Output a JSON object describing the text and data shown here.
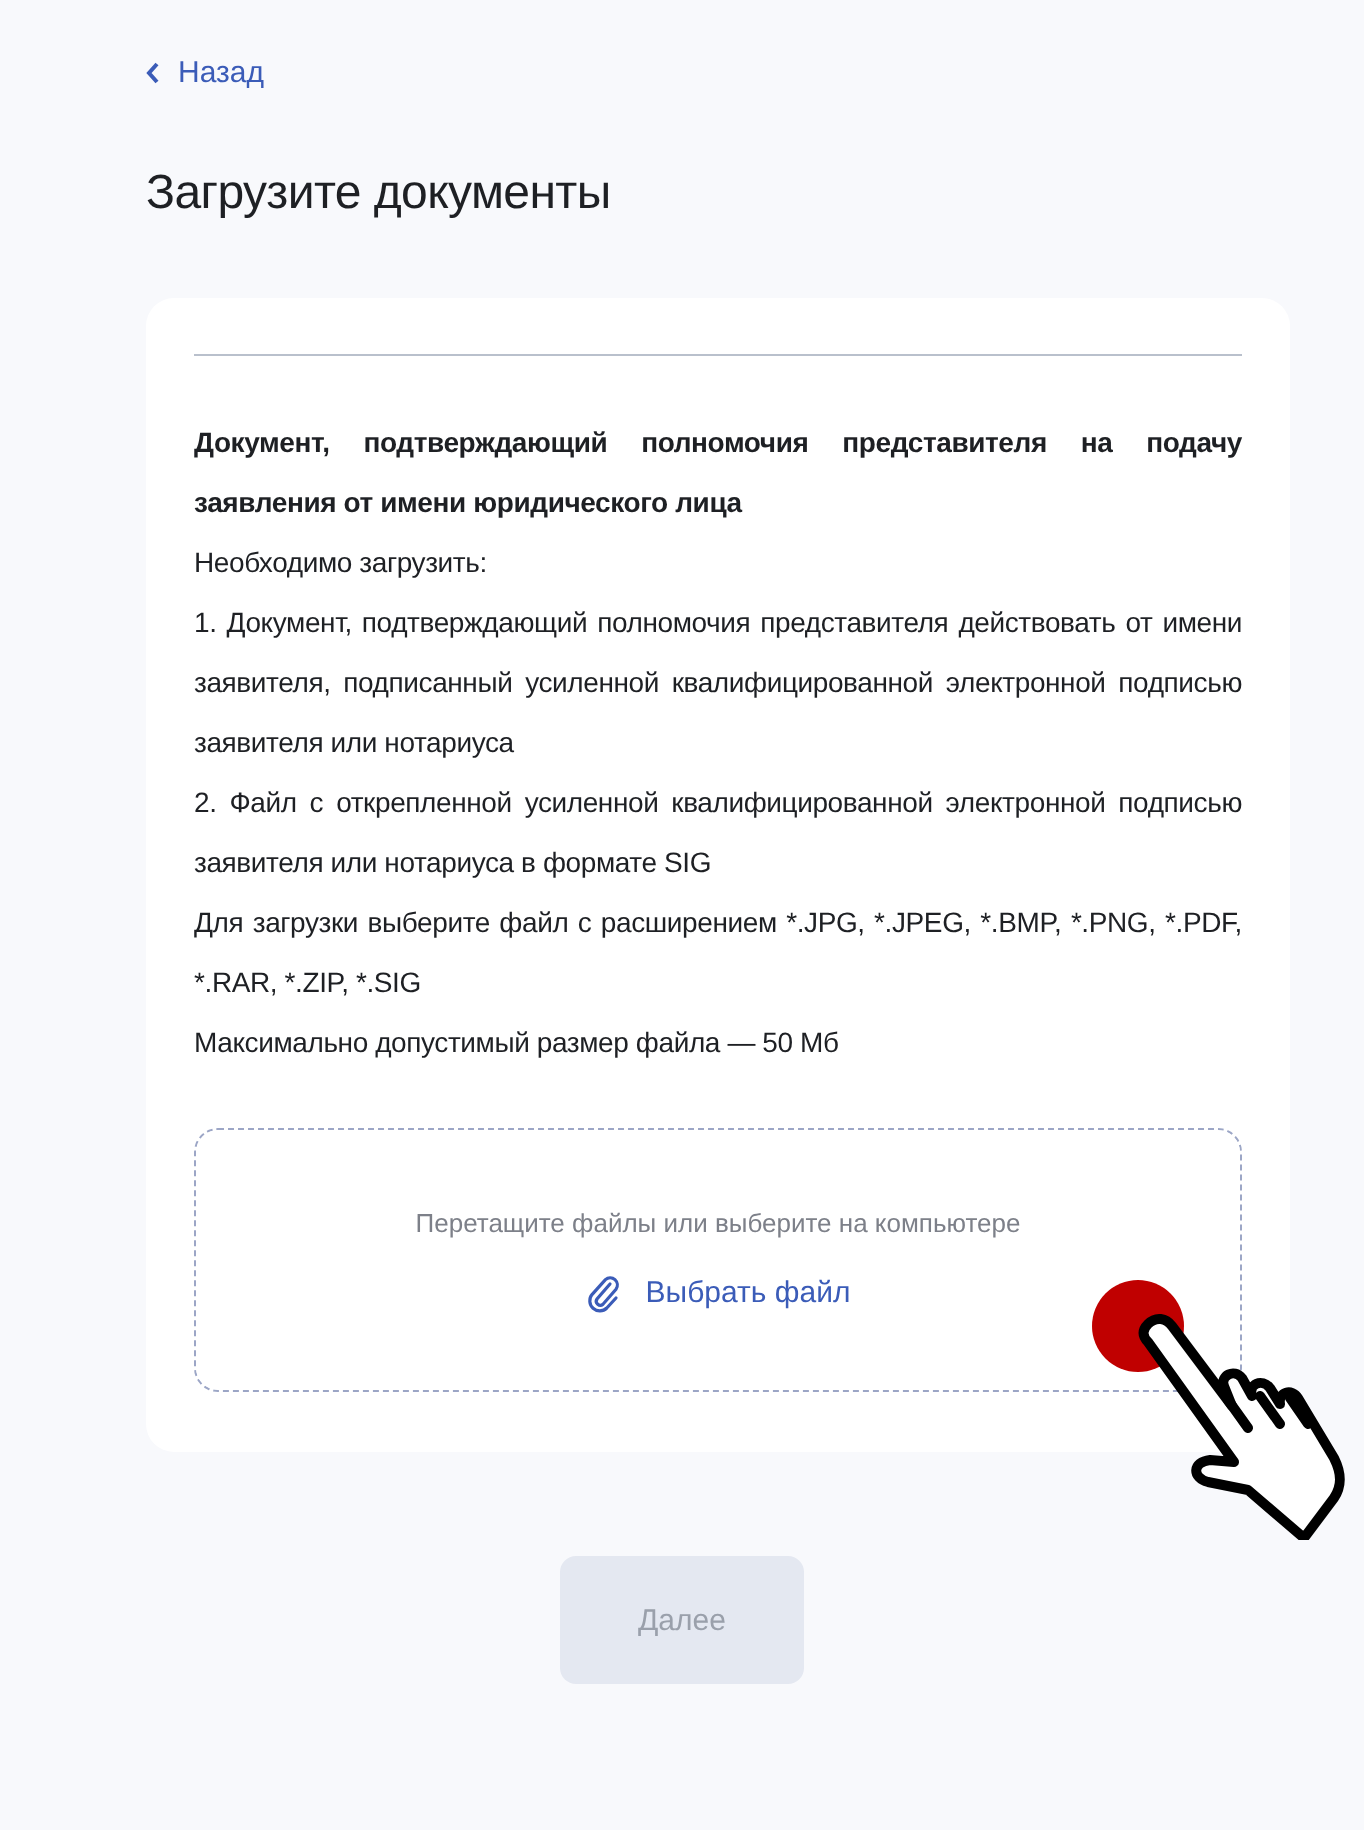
{
  "back_link": {
    "label": "Назад"
  },
  "title": "Загрузите документы",
  "document": {
    "heading": "Документ, подтверждающий полномочия представителя на подачу заявления от имени юридического лица",
    "paragraphs": [
      "Необходимо загрузить:",
      "1. Документ, подтверждающий полномочия представителя действовать от имени заявителя, подписанный усиленной квалифицированной электронной подписью заявителя или нотариуса",
      "2. Файл с открепленной усиленной квалифицированной электронной подписью заявителя или нотариуса в формате SIG",
      "Для загрузки выберите файл с расширением *.JPG, *.JPEG, *.BMP, *.PNG, *.PDF, *.RAR, *.ZIP, *.SIG",
      "Максимально допустимый размер файла — 50 Мб"
    ]
  },
  "dropzone": {
    "hint": "Перетащите файлы или выберите на компьютере",
    "button": "Выбрать файл"
  },
  "next_button": {
    "label": "Далее",
    "disabled": true
  }
}
